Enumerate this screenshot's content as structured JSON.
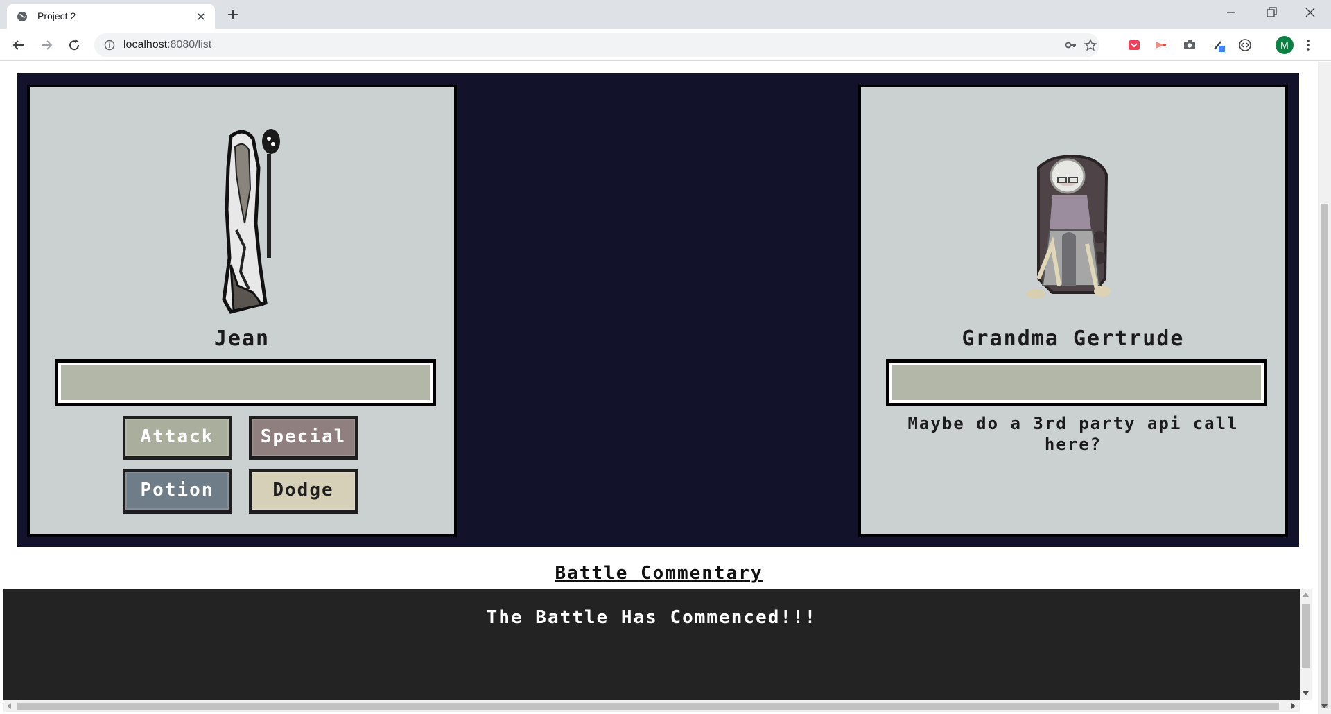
{
  "browser": {
    "tab_title": "Project 2",
    "url_host": "localhost",
    "url_path": ":8080/list",
    "profile_initial": "M"
  },
  "player": {
    "name": "Jean",
    "buttons": {
      "attack": "Attack",
      "special": "Special",
      "potion": "Potion",
      "dodge": "Dodge"
    }
  },
  "enemy": {
    "name": "Grandma Gertrude",
    "note": "Maybe do a 3rd party api call here?"
  },
  "commentary": {
    "title": "Battle Commentary",
    "message": "The Battle Has Commenced!!!"
  },
  "colors": {
    "arena_bg": "#12132a",
    "card_bg": "#cbd1d1",
    "health_fill": "#b2b7a7",
    "attack_btn": "#a9ae9d",
    "special_btn": "#8f7f7f",
    "potion_btn": "#6f7d88",
    "dodge_btn": "#d6d0b9",
    "commentary_bg": "#232323"
  }
}
